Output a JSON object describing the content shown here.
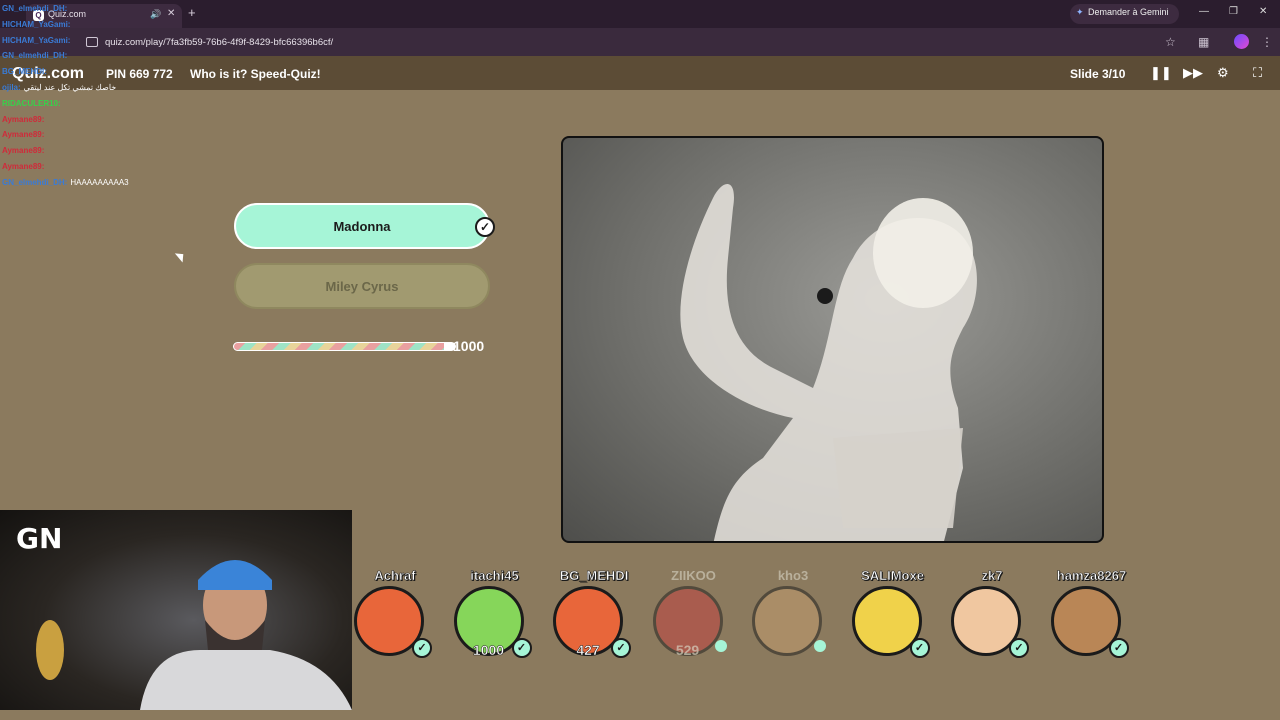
{
  "browser": {
    "tab_title": "Quiz.com",
    "url": "quiz.com/play/7fa3fb59-76b6-4f9f-8429-bfc66396b6cf/",
    "gemini_label": "Demander à Gemini"
  },
  "quiz": {
    "logo": "Quiz.com",
    "pin": "PIN 669 772",
    "title": "Who is it? Speed-Quiz!",
    "slide": "Slide 3/10"
  },
  "chat": [
    {
      "user": "GN_elmehdi_DH:",
      "msg": "",
      "color": "blue"
    },
    {
      "user": "HICHAM_YaGami:",
      "msg": "",
      "color": "blue"
    },
    {
      "user": "HICHAM_YaGami:",
      "msg": "",
      "color": "blue"
    },
    {
      "user": "GN_elmehdi_DH:",
      "msg": "",
      "color": "blue"
    },
    {
      "user": "BG_MEHDI:",
      "msg": "",
      "color": "blue"
    },
    {
      "user": "ojila:",
      "msg": "خاصك تمشي تكل عند ليتقي",
      "color": "blue"
    },
    {
      "user": "RIDACULER10:",
      "msg": "",
      "color": "green"
    },
    {
      "user": "Aymane89:",
      "msg": "",
      "color": "red"
    },
    {
      "user": "Aymane89:",
      "msg": "",
      "color": "red"
    },
    {
      "user": "Aymane89:",
      "msg": "",
      "color": "red"
    },
    {
      "user": "Aymane89:",
      "msg": "",
      "color": "red"
    },
    {
      "user": "GN_elmehdi_DH:",
      "msg": "HAAAAAAAAA3",
      "color": "blue"
    }
  ],
  "answers": {
    "correct": "Madonna",
    "wrong": "Miley Cyrus"
  },
  "progress": {
    "value_label": "1000",
    "fraction": 1.0
  },
  "players": [
    {
      "name": "Achraf",
      "score": "",
      "status": "correct",
      "color": "#e8663a"
    },
    {
      "name": "itachi45",
      "score": "1000",
      "status": "correct",
      "color": "#86d65a"
    },
    {
      "name": "BG_MEHDI",
      "score": "427",
      "status": "correct",
      "color": "#e8663a"
    },
    {
      "name": "ZIIKOO",
      "score": "529",
      "status": "pending",
      "color": "#c84040"
    },
    {
      "name": "kho3",
      "score": "",
      "status": "pending",
      "color": "#c9a070"
    },
    {
      "name": "SALIMoxe",
      "score": "",
      "status": "correct",
      "color": "#f0d24a"
    },
    {
      "name": "zk7",
      "score": "",
      "status": "correct",
      "color": "#f0c7a0"
    },
    {
      "name": "hamza8267",
      "score": "",
      "status": "correct",
      "color": "#b98656"
    }
  ]
}
